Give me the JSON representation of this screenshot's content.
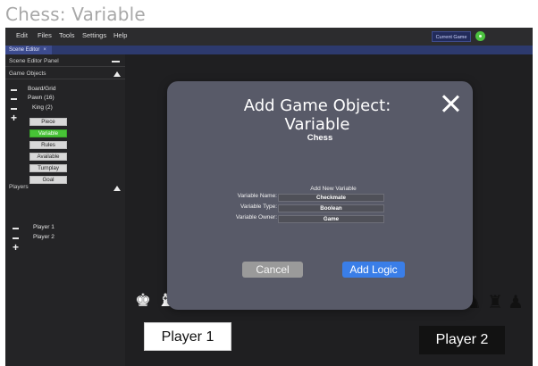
{
  "page_title": "Chess: Variable",
  "menu": [
    "Edit",
    "Files",
    "Tools",
    "Settings",
    "Help"
  ],
  "current_game_label": "Current Game",
  "active_tab": "Scene Editor",
  "panel": {
    "title": "Scene Editor Panel",
    "game_objects_label": "Game Objects",
    "tree": [
      "Board/Grid",
      "Pawn (16)",
      "King (2)"
    ],
    "buttons": [
      "Piece",
      "Variable",
      "Rules",
      "Available",
      "Turnplay",
      "Goal"
    ],
    "active_button": "Variable",
    "players_label": "Players",
    "players": [
      "Player 1",
      "Player 2"
    ]
  },
  "board": {
    "player1": "Player 1",
    "player2": "Player 2"
  },
  "modal": {
    "title": "Add Game Object: Variable",
    "game_name": "Chess",
    "form_caption": "Add New Variable",
    "fields": [
      {
        "label": "Variable Name:",
        "value": "Checkmate"
      },
      {
        "label": "Variable Type:",
        "value": "Boolean"
      },
      {
        "label": "Variable Owner:",
        "value": "Game"
      }
    ],
    "cancel_label": "Cancel",
    "submit_label": "Add Logic"
  },
  "colors": {
    "accent_blue": "#3a7ee8",
    "active_green": "#47c336",
    "modal_bg": "#585a68"
  }
}
